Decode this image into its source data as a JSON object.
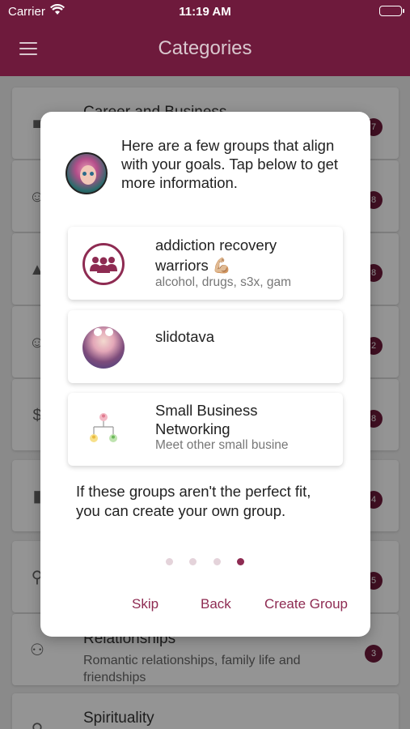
{
  "status_bar": {
    "carrier": "Carrier",
    "time": "11:19 AM"
  },
  "header": {
    "title": "Categories"
  },
  "categories": [
    {
      "title": "Career and Business",
      "description": "",
      "badge": "7",
      "icon": "briefcase-icon"
    },
    {
      "title": "",
      "description": "",
      "badge": "8",
      "icon": "person-icon"
    },
    {
      "title": "",
      "description": "",
      "badge": "8",
      "icon": "graduation-cap-icon"
    },
    {
      "title": "",
      "description": "",
      "badge": "2",
      "icon": "smiley-icon"
    },
    {
      "title": "",
      "description": "",
      "badge": "8",
      "icon": "dollar-icon"
    },
    {
      "title": "",
      "description": "",
      "badge": "4",
      "icon": "book-icon"
    },
    {
      "title": "",
      "description": "",
      "badge": "5",
      "icon": "search-icon"
    },
    {
      "title": "Relationships",
      "description": "Romantic relationships, family life and friendships",
      "badge": "3",
      "icon": "family-icon"
    },
    {
      "title": "Spirituality",
      "description": "",
      "badge": "",
      "icon": "spirit-icon"
    }
  ],
  "dialog": {
    "intro": "Here are a few groups that align with your goals. Tap below to get more information.",
    "groups": [
      {
        "name": "addiction recovery warriors 💪🏼",
        "description": "alcohol, drugs, s3x, gam",
        "icon": "group-people-icon"
      },
      {
        "name": "slidotava",
        "description": "",
        "icon": "user-photo-icon"
      },
      {
        "name": "Small Business Networking",
        "description": "Meet other small busine",
        "icon": "network-icon"
      }
    ],
    "outro": "If these groups aren't the perfect fit, you can create your own group.",
    "pager": {
      "total": 4,
      "current": 4
    },
    "actions": {
      "skip": "Skip",
      "back": "Back",
      "create": "Create Group"
    }
  },
  "colors": {
    "brand": "#6e1a3c",
    "accent": "#8e2b52"
  }
}
